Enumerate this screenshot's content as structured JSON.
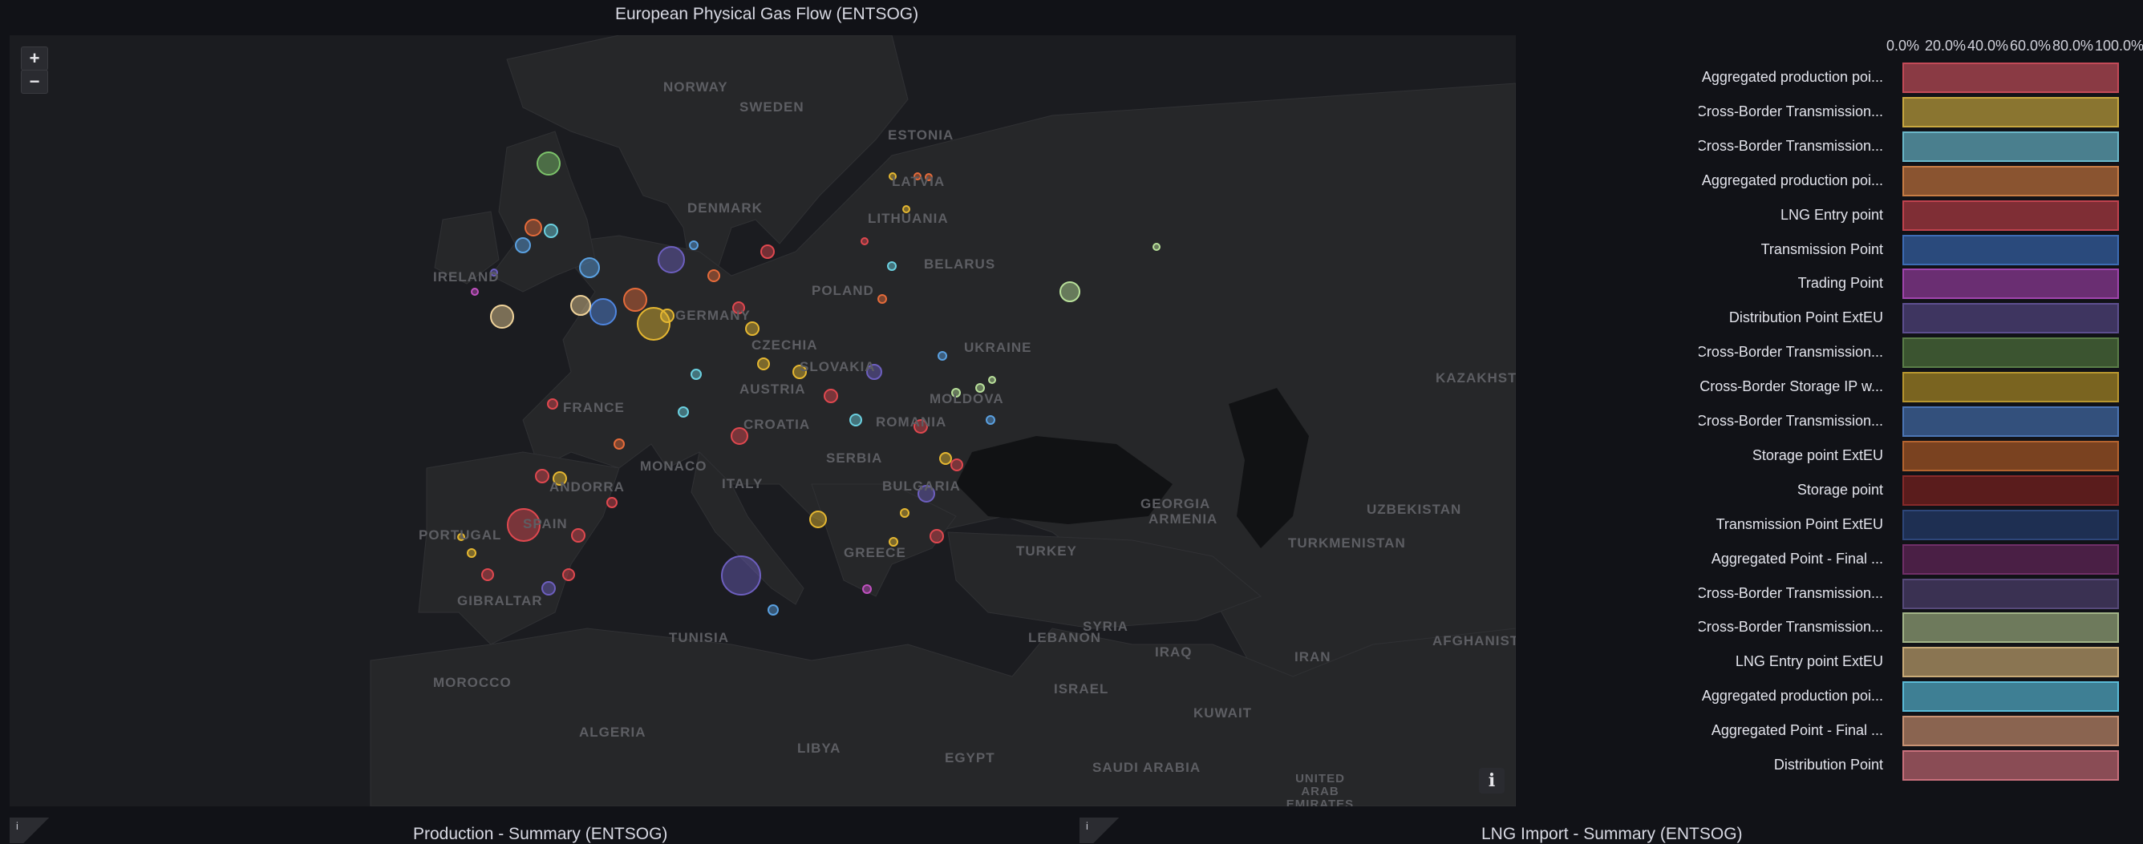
{
  "map_panel": {
    "title": "European Physical Gas Flow (ENTSOG)",
    "zoom_in": "+",
    "zoom_out": "−",
    "info": "i",
    "countries": [
      "NORWAY",
      "SWEDEN",
      "ESTONIA",
      "LATVIA",
      "LITHUANIA",
      "DENMARK",
      "BELARUS",
      "IRELAND",
      "POLAND",
      "GERMANY",
      "CZECHIA",
      "SLOVAKIA",
      "UKRAINE",
      "KAZAKHSTAN",
      "AUSTRIA",
      "FRANCE",
      "MOLDOVA",
      "ROMANIA",
      "SERBIA",
      "CROATIA",
      "MONACO",
      "ANDORRA",
      "BULGARIA",
      "ITALY",
      "PORTUGAL",
      "SPAIN",
      "GIBRALTAR",
      "GREECE",
      "TURKEY",
      "GEORGIA",
      "ARMENIA",
      "UZBEKISTAN",
      "TURKMENISTAN",
      "TUNISIA",
      "MOROCCO",
      "ALGERIA",
      "LIBYA",
      "EGYPT",
      "ISRAEL",
      "LEBANON",
      "SYRIA",
      "IRAQ",
      "IRAN",
      "KUWAIT",
      "SAUDI ARABIA",
      "UNITED ARAB EMIRATES",
      "AFGHANISTAN"
    ]
  },
  "legend_chart": {
    "x_ticks": [
      "0.0%",
      "20.0%",
      "40.0%",
      "60.0%",
      "80.0%",
      "100.0%"
    ],
    "rows": [
      {
        "label": "Aggregated production poi...",
        "value": 100,
        "color": "#8a3a44",
        "border": "#c34a58"
      },
      {
        "label": "Cross-Border Transmission...",
        "value": 100,
        "color": "#8a7530",
        "border": "#c9a840"
      },
      {
        "label": "Cross-Border Transmission...",
        "value": 100,
        "color": "#4a7f8e",
        "border": "#6bb8c9"
      },
      {
        "label": "Aggregated production poi...",
        "value": 100,
        "color": "#8a5430",
        "border": "#c87d45"
      },
      {
        "label": "LNG Entry point",
        "value": 100,
        "color": "#7f2e35",
        "border": "#c0434e"
      },
      {
        "label": "Transmission Point",
        "value": 100,
        "color": "#2a4a7c",
        "border": "#3d6cb5"
      },
      {
        "label": "Trading Point",
        "value": 100,
        "color": "#6a2e72",
        "border": "#a045ad"
      },
      {
        "label": "Distribution Point ExtEU",
        "value": 100,
        "color": "#3e3560",
        "border": "#5d4f8f"
      },
      {
        "label": "Cross-Border Transmission...",
        "value": 100,
        "color": "#3b5430",
        "border": "#5a7d48"
      },
      {
        "label": "Cross-Border Storage IP w...",
        "value": 100,
        "color": "#7a6420",
        "border": "#b8962f"
      },
      {
        "label": "Cross-Border Transmission...",
        "value": 100,
        "color": "#33507c",
        "border": "#4c76b5"
      },
      {
        "label": "Storage point ExtEU",
        "value": 100,
        "color": "#7a4220",
        "border": "#b5642f"
      },
      {
        "label": "Storage point",
        "value": 100,
        "color": "#5a1c1c",
        "border": "#872a2a"
      },
      {
        "label": "Transmission Point ExtEU",
        "value": 100,
        "color": "#1e2f52",
        "border": "#2e4679"
      },
      {
        "label": "Aggregated Point - Final ...",
        "value": 100,
        "color": "#4a1f45",
        "border": "#702f68"
      },
      {
        "label": "Cross-Border Transmission...",
        "value": 100,
        "color": "#3a3152",
        "border": "#574a7a"
      },
      {
        "label": "Cross-Border Transmission...",
        "value": 100,
        "color": "#6e7a5c",
        "border": "#a3b588"
      },
      {
        "label": "LNG Entry point ExtEU",
        "value": 100,
        "color": "#8a7552",
        "border": "#c9ab78"
      },
      {
        "label": "Aggregated production poi...",
        "value": 100,
        "color": "#3e7f94",
        "border": "#5bbcd8"
      },
      {
        "label": "Aggregated Point - Final ...",
        "value": 100,
        "color": "#8a6450",
        "border": "#c99374"
      },
      {
        "label": "Distribution Point",
        "value": 100,
        "color": "#8a4c55",
        "border": "#c9707c"
      }
    ]
  },
  "bottom_panels": {
    "left_title": "Production - Summary (ENTSOG)",
    "right_title": "LNG Import - Summary (ENTSOG)",
    "info": "i"
  }
}
